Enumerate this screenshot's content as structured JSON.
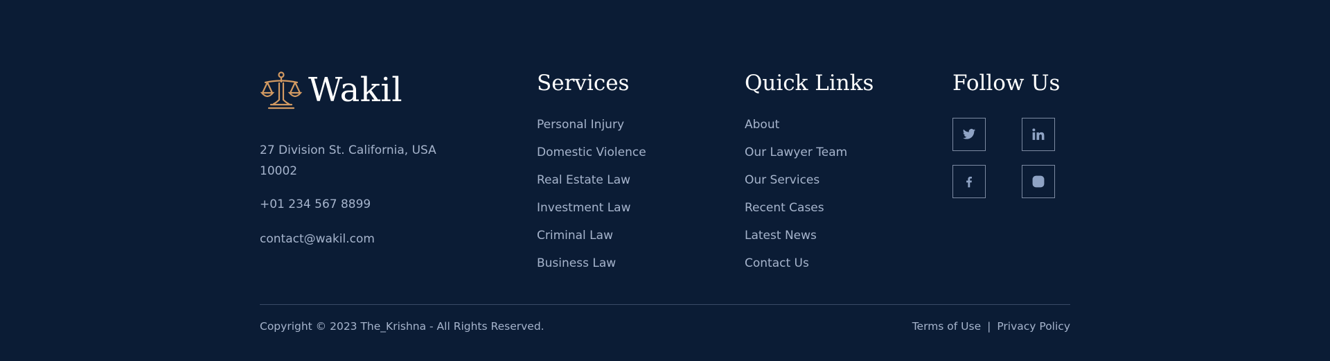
{
  "brand": {
    "name": "Wakil",
    "logo_icon": "scales-of-justice-icon",
    "accent_color": "#d39a62"
  },
  "contact": {
    "address": "27 Division St. California, USA 10002",
    "phone": "+01 234 567 8899",
    "email": "contact@wakil.com"
  },
  "services": {
    "heading": "Services",
    "items": [
      "Personal Injury",
      "Domestic Violence",
      "Real Estate Law",
      "Investment Law",
      "Criminal Law",
      "Business Law"
    ]
  },
  "quick_links": {
    "heading": "Quick Links",
    "items": [
      "About",
      "Our Lawyer Team",
      "Our Services",
      "Recent Cases",
      "Latest News",
      "Contact Us"
    ]
  },
  "follow": {
    "heading": "Follow Us",
    "icons": [
      "twitter-icon",
      "linkedin-icon",
      "facebook-icon",
      "instagram-icon"
    ]
  },
  "bottom": {
    "copyright": "Copyright © 2023 The_Krishna - All Rights Reserved.",
    "terms": "Terms of Use",
    "separator": "|",
    "privacy": "Privacy Policy"
  },
  "colors": {
    "background": "#0b1c35",
    "text": "#a6b4cc",
    "heading": "#ffffff"
  }
}
